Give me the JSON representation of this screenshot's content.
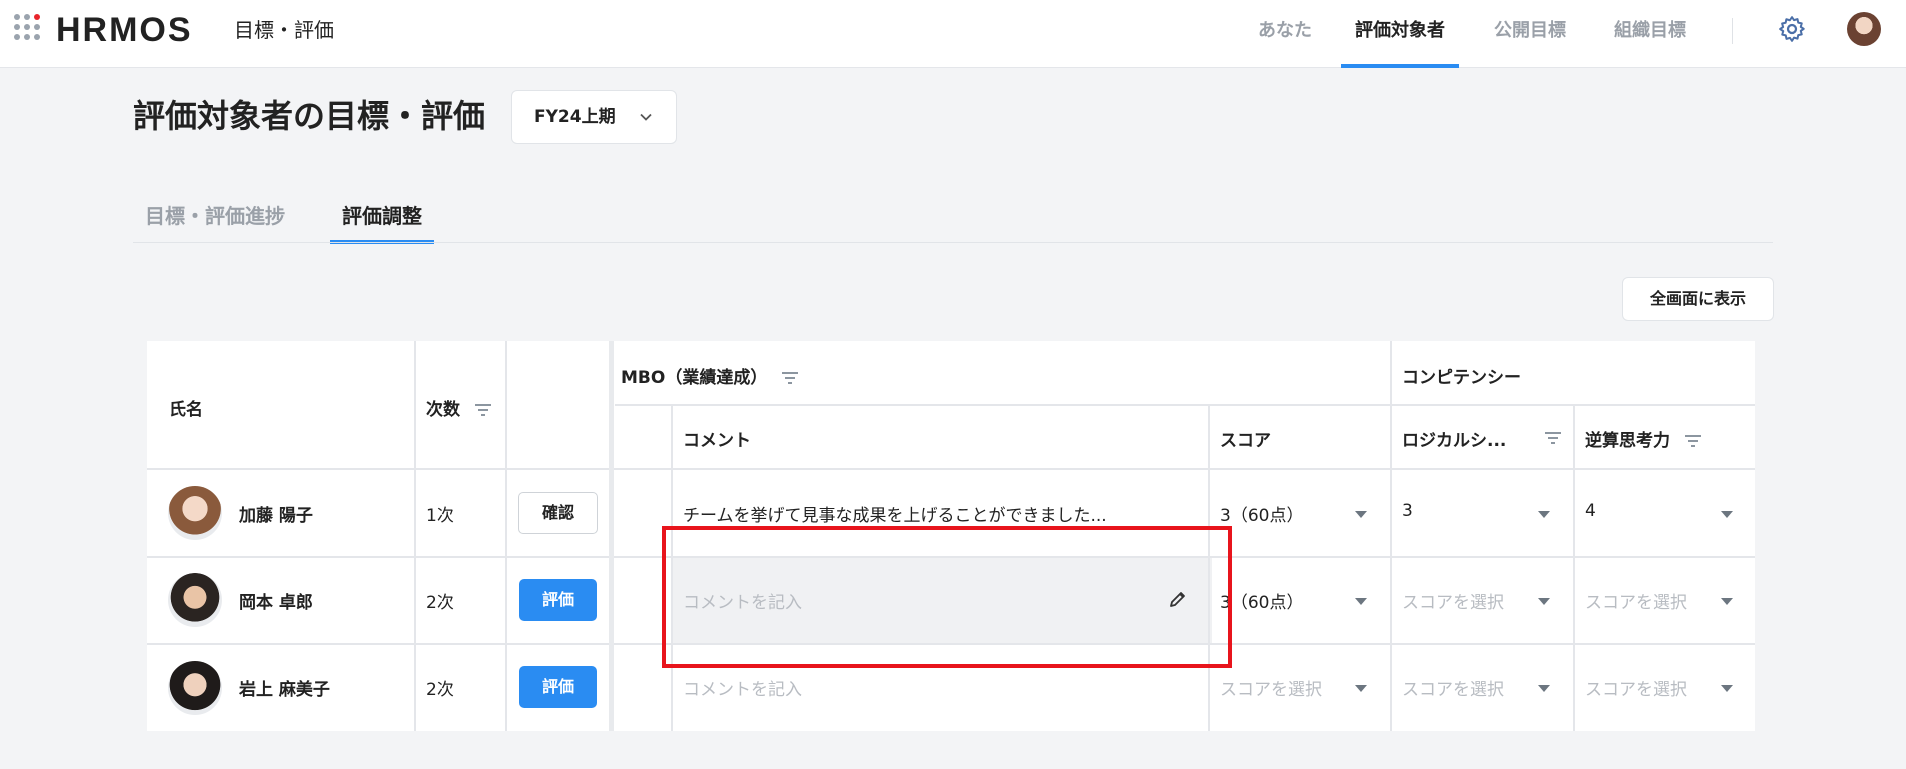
{
  "header": {
    "logo": "HRMOS",
    "product": "目標・評価",
    "nav": [
      {
        "label": "あなた",
        "active": false
      },
      {
        "label": "評価対象者",
        "active": true
      },
      {
        "label": "公開目標",
        "active": false
      },
      {
        "label": "組織目標",
        "active": false
      }
    ],
    "icons": [
      "apps-grid-icon",
      "gear-icon",
      "avatar"
    ]
  },
  "page": {
    "title": "評価対象者の目標・評価",
    "period": "FY24上期",
    "tabs": [
      {
        "label": "目標・評価進捗",
        "active": false
      },
      {
        "label": "評価調整",
        "active": true
      }
    ],
    "fullscreen_label": "全画面に表示"
  },
  "table": {
    "headers": {
      "name": "氏名",
      "round": "次数",
      "mbo_group": "MBO（業績達成）",
      "competency_group": "コンピテンシー",
      "comment": "コメント",
      "score": "スコア",
      "logical": "ロジカルシ...",
      "backcasting": "逆算思考力"
    },
    "rows": [
      {
        "name": "加藤 陽子",
        "round": "1次",
        "action": "確認",
        "action_style": "outline",
        "comment": "チームを挙げて見事な成果を上げることができました...",
        "comment_placeholder": false,
        "score": "3（60点）",
        "score_placeholder": false,
        "logical": "3",
        "logical_placeholder": false,
        "backcasting": "4",
        "backcasting_placeholder": false
      },
      {
        "name": "岡本 卓郎",
        "round": "2次",
        "action": "評価",
        "action_style": "primary",
        "comment": "コメントを記入",
        "comment_placeholder": true,
        "score": "3（60点）",
        "score_placeholder": false,
        "logical": "スコアを選択",
        "logical_placeholder": true,
        "backcasting": "スコアを選択",
        "backcasting_placeholder": true
      },
      {
        "name": "岩上 麻美子",
        "round": "2次",
        "action": "評価",
        "action_style": "primary",
        "comment": "コメントを記入",
        "comment_placeholder": true,
        "score": "スコアを選択",
        "score_placeholder": true,
        "logical": "スコアを選択",
        "logical_placeholder": true,
        "backcasting": "スコアを選択",
        "backcasting_placeholder": true
      }
    ]
  },
  "colors": {
    "accent": "#2a8cf2",
    "highlight": "#e8141c",
    "brand_dot": "#e8242b"
  }
}
